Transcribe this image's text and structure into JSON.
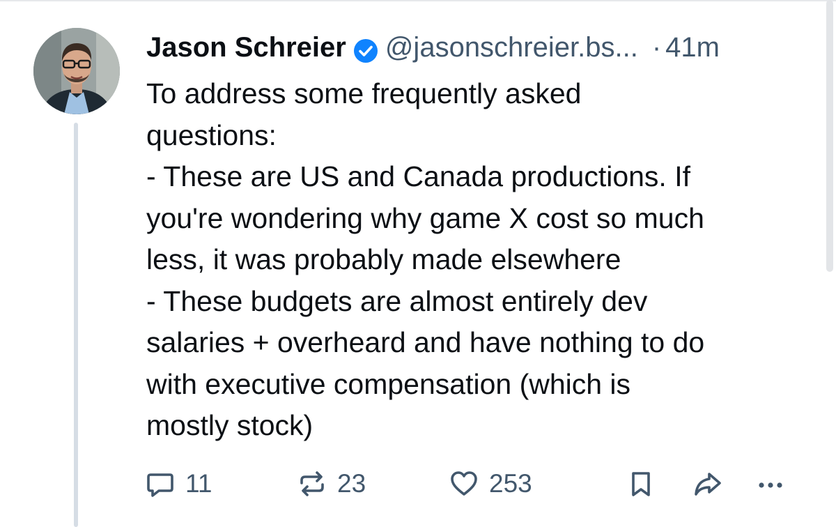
{
  "post": {
    "author_name": "Jason Schreier",
    "handle": "@jasonschreier.bs...",
    "separator": "·",
    "time": "41m",
    "lines": [
      "To address some frequently asked",
      "questions:",
      "- These are US and Canada productions. If",
      "you're wondering why game X cost so much",
      "less, it was probably made elsewhere",
      "- These budgets are almost entirely dev",
      "salaries + overheard and have nothing to do",
      "with executive compensation (which is",
      "mostly stock)"
    ]
  },
  "actions": {
    "reply_count": "11",
    "repost_count": "23",
    "like_count": "253"
  },
  "icons": {
    "avatar": "avatar-photo",
    "verified": "verified-badge-icon",
    "reply": "reply-icon",
    "repost": "repost-icon",
    "like": "heart-icon",
    "bookmark": "bookmark-icon",
    "share": "share-icon",
    "more": "more-options-icon"
  },
  "colors": {
    "text": "#0b0f14",
    "muted": "#42576c",
    "verified_blue": "#1083fe",
    "thread_line": "#d6dde5"
  }
}
